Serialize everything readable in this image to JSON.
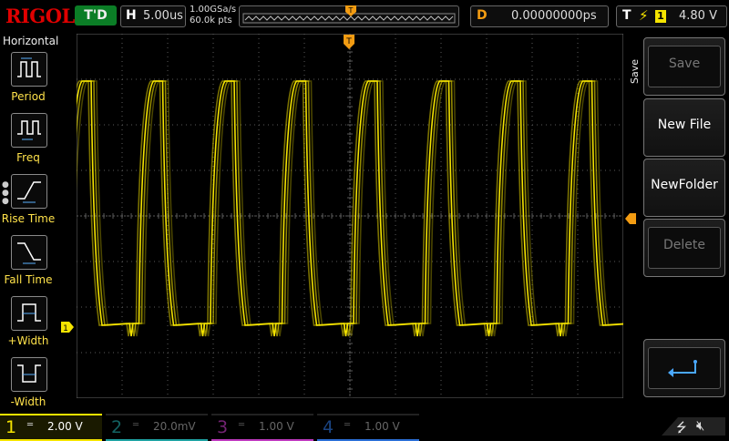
{
  "header": {
    "logo": "RIGOL",
    "trigger_status": "T'D",
    "horizontal_key": "H",
    "timebase": "5.00us",
    "sample_rate": "1.00GSa/s",
    "memory_points": "60.0k pts",
    "trigger_marker": "T",
    "delay_key": "D",
    "delay_value": "0.00000000ps",
    "trigger_key": "T",
    "trigger_source": "1",
    "trigger_level": "4.80 V"
  },
  "left_menu": {
    "title": "Horizontal",
    "items": [
      {
        "label": "Period",
        "icon": "period-icon"
      },
      {
        "label": "Freq",
        "icon": "frequency-icon"
      },
      {
        "label": "Rise Time",
        "icon": "rise-time-icon"
      },
      {
        "label": "Fall Time",
        "icon": "fall-time-icon"
      },
      {
        "label": "+Width",
        "icon": "positive-width-icon"
      },
      {
        "label": "-Width",
        "icon": "negative-width-icon"
      }
    ]
  },
  "right_menu": {
    "title": "Save",
    "buttons": [
      {
        "label": "Save",
        "enabled": false
      },
      {
        "label": "New File",
        "enabled": true
      },
      {
        "label": "NewFolder",
        "enabled": true
      },
      {
        "label": "Delete",
        "enabled": false
      },
      {
        "label": "",
        "icon": "return-arrow-icon",
        "enabled": true
      }
    ]
  },
  "display": {
    "ch1_marker": "1",
    "trigger_top_marker": "T",
    "waveform_color": "#f5e400",
    "grid_color": "#5a5a5a"
  },
  "channels": [
    {
      "num": "1",
      "coupling": "═",
      "scale": "2.00 V",
      "color": "#f5e400",
      "active": true
    },
    {
      "num": "2",
      "coupling": "═",
      "scale": "20.0mV",
      "color": "#1fa3a3",
      "active": false
    },
    {
      "num": "3",
      "coupling": "═",
      "scale": "1.00 V",
      "color": "#c03bc0",
      "active": false
    },
    {
      "num": "4",
      "coupling": "═",
      "scale": "1.00 V",
      "color": "#2b6fd6",
      "active": false
    }
  ],
  "status": {
    "usb_icon": "usb-icon",
    "sound_icon": "speaker-mute-icon"
  }
}
